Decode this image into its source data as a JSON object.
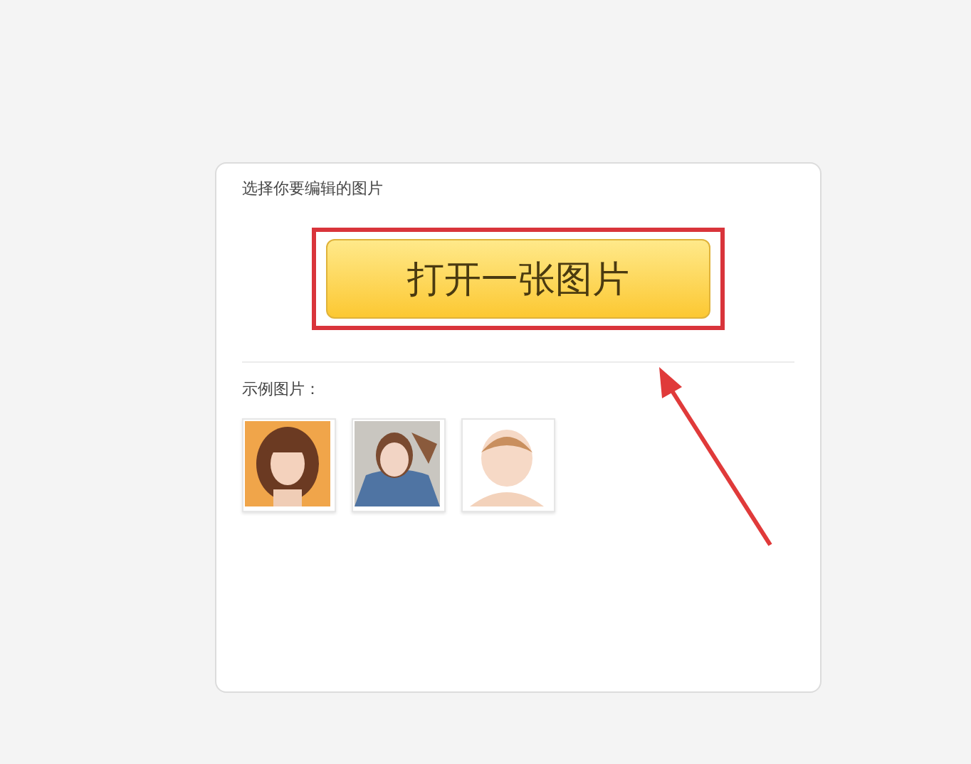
{
  "panel": {
    "title": "选择你要编辑的图片",
    "open_button": {
      "label": "打开一张图片",
      "highlighted": true
    },
    "samples_label": "示例图片："
  },
  "annotation": {
    "arrow": true
  }
}
